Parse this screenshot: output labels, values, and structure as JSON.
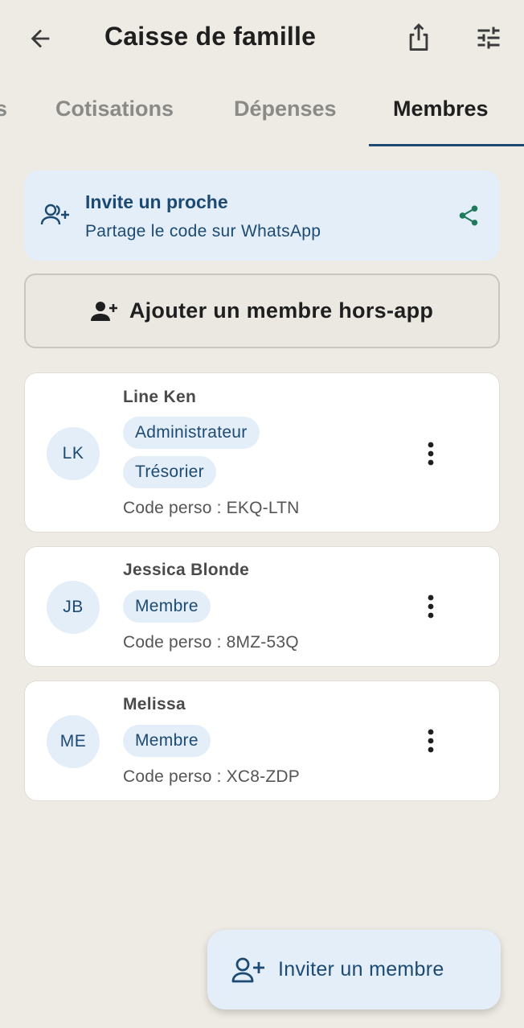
{
  "header": {
    "title": "Caisse de famille",
    "icons": {
      "back": "arrow-left-icon",
      "share": "share-upload-icon",
      "filter": "tune-sliders-icon"
    }
  },
  "tabs": {
    "partial": "s",
    "items": [
      {
        "label": "Cotisations"
      },
      {
        "label": "Dépenses"
      },
      {
        "label": "Membres"
      }
    ],
    "active_index": 2
  },
  "invite_card": {
    "title": "Invite un proche",
    "subtitle": "Partage le code sur WhatsApp",
    "icons": {
      "left": "group-add-icon",
      "right": "share-icon"
    }
  },
  "add_offline": {
    "label": "Ajouter un membre hors-app",
    "icon": "person-add-icon"
  },
  "members": [
    {
      "initials": "LK",
      "name": "Line Ken",
      "roles": [
        "Administrateur",
        "Trésorier"
      ],
      "code": "Code perso : EKQ-LTN"
    },
    {
      "initials": "JB",
      "name": "Jessica Blonde",
      "roles": [
        "Membre"
      ],
      "code": "Code perso : 8MZ-53Q"
    },
    {
      "initials": "ME",
      "name": "Melissa",
      "roles": [
        "Membre"
      ],
      "code": "Code perso : XC8-ZDP"
    }
  ],
  "fab": {
    "label": "Inviter un membre",
    "icon": "person-add-outline-icon"
  },
  "colors": {
    "background": "#eeebe4",
    "accent": "#1d4a72",
    "chip_bg": "#e3eef8",
    "whatsapp_green": "#1e7a5a"
  }
}
